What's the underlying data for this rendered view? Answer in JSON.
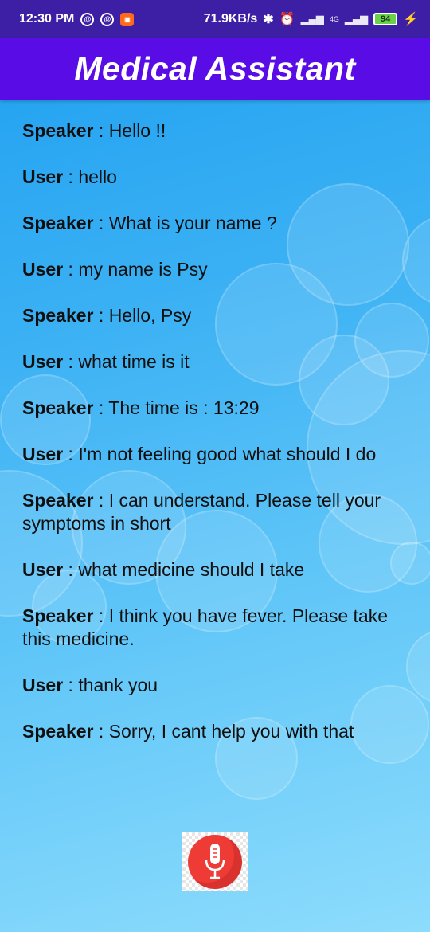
{
  "status_bar": {
    "time": "12:30 PM",
    "network_speed": "71.9KB/s",
    "network_type": "4G",
    "battery": "94",
    "icons": [
      "at-icon",
      "at-icon",
      "app-notification-icon",
      "bluetooth-icon",
      "alarm-icon",
      "signal-icon",
      "signal-icon",
      "battery-icon",
      "charging-icon"
    ]
  },
  "header": {
    "title": "Medical Assistant"
  },
  "conversation": [
    {
      "role": "Speaker",
      "separator": " : ",
      "text": "Hello !!"
    },
    {
      "role": "User",
      "separator": " : ",
      "text": "hello"
    },
    {
      "role": "Speaker",
      "separator": " : ",
      "text": "What is your name ?"
    },
    {
      "role": "User",
      "separator": " : ",
      "text": "my name is Psy"
    },
    {
      "role": "Speaker",
      "separator": " : ",
      "text": "Hello, Psy"
    },
    {
      "role": "User",
      "separator": " : ",
      "text": "what time is it"
    },
    {
      "role": "Speaker",
      "separator": " : ",
      "text": "The time is : 13:29"
    },
    {
      "role": "User",
      "separator": " : ",
      "text": "I'm not feeling good what should I do"
    },
    {
      "role": "Speaker",
      "separator": " : ",
      "text": "I can understand. Please tell your symptoms in short"
    },
    {
      "role": "User",
      "separator": " : ",
      "text": "what medicine should I take"
    },
    {
      "role": "Speaker",
      "separator": " : ",
      "text": "I think you have fever. Please take this medicine."
    },
    {
      "role": "User",
      "separator": " : ",
      "text": "thank you"
    },
    {
      "role": "Speaker",
      "separator": " : ",
      "text": "Sorry, I cant help you with that"
    }
  ],
  "mic_button": {
    "icon": "microphone-icon"
  },
  "colors": {
    "status_bar": "#3d1fa6",
    "header": "#5a0ce6",
    "background_top": "#1e9ff0",
    "background_bottom": "#8ddcfc",
    "mic": "#ef3b36"
  }
}
